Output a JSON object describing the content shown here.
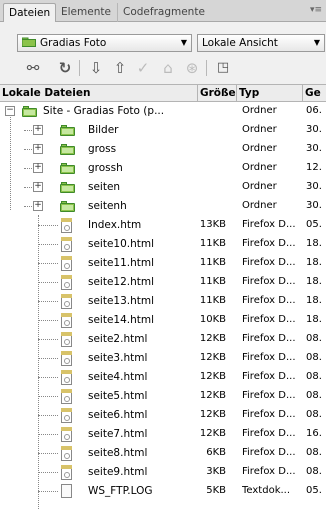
{
  "tabs": [
    {
      "label": "Dateien",
      "active": true
    },
    {
      "label": "Elemente",
      "active": false
    },
    {
      "label": "Codefragmente",
      "active": false
    }
  ],
  "panel_menu_icon": "panel-options-icon",
  "site_select": {
    "value": "Gradias Foto"
  },
  "view_select": {
    "value": "Lokale Ansicht"
  },
  "toolbar": {
    "icons": [
      "connect-icon",
      "refresh-icon",
      "get-files-icon",
      "put-files-icon",
      "check-out-icon",
      "check-in-icon",
      "synchronize-icon",
      "expand-icon"
    ]
  },
  "columns": {
    "name": "Lokale Dateien",
    "size": "Größe",
    "type": "Typ",
    "date": "Ge"
  },
  "root": {
    "name": "Site - Gradias Foto (p...",
    "size": "",
    "type": "Ordner",
    "date": "06."
  },
  "folders": [
    {
      "name": "Bilder",
      "type": "Ordner",
      "date": "30."
    },
    {
      "name": "gross",
      "type": "Ordner",
      "date": "30."
    },
    {
      "name": "grossh",
      "type": "Ordner",
      "date": "12."
    },
    {
      "name": "seiten",
      "type": "Ordner",
      "date": "30."
    },
    {
      "name": "seitenh",
      "type": "Ordner",
      "date": "30."
    }
  ],
  "files": [
    {
      "name": "Index.htm",
      "size": "13KB",
      "type": "Firefox D...",
      "date": "05."
    },
    {
      "name": "seite10.html",
      "size": "11KB",
      "type": "Firefox D...",
      "date": "18."
    },
    {
      "name": "seite11.html",
      "size": "11KB",
      "type": "Firefox D...",
      "date": "18."
    },
    {
      "name": "seite12.html",
      "size": "11KB",
      "type": "Firefox D...",
      "date": "18."
    },
    {
      "name": "seite13.html",
      "size": "11KB",
      "type": "Firefox D...",
      "date": "18."
    },
    {
      "name": "seite14.html",
      "size": "10KB",
      "type": "Firefox D...",
      "date": "18."
    },
    {
      "name": "seite2.html",
      "size": "12KB",
      "type": "Firefox D...",
      "date": "08."
    },
    {
      "name": "seite3.html",
      "size": "12KB",
      "type": "Firefox D...",
      "date": "08."
    },
    {
      "name": "seite4.html",
      "size": "12KB",
      "type": "Firefox D...",
      "date": "08."
    },
    {
      "name": "seite5.html",
      "size": "12KB",
      "type": "Firefox D...",
      "date": "08."
    },
    {
      "name": "seite6.html",
      "size": "12KB",
      "type": "Firefox D...",
      "date": "08."
    },
    {
      "name": "seite7.html",
      "size": "12KB",
      "type": "Firefox D...",
      "date": "16."
    },
    {
      "name": "seite8.html",
      "size": "6KB",
      "type": "Firefox D...",
      "date": "08."
    },
    {
      "name": "seite9.html",
      "size": "3KB",
      "type": "Firefox D...",
      "date": "08."
    },
    {
      "name": "WS_FTP.LOG",
      "size": "5KB",
      "type": "Textdok...",
      "date": "05."
    }
  ]
}
